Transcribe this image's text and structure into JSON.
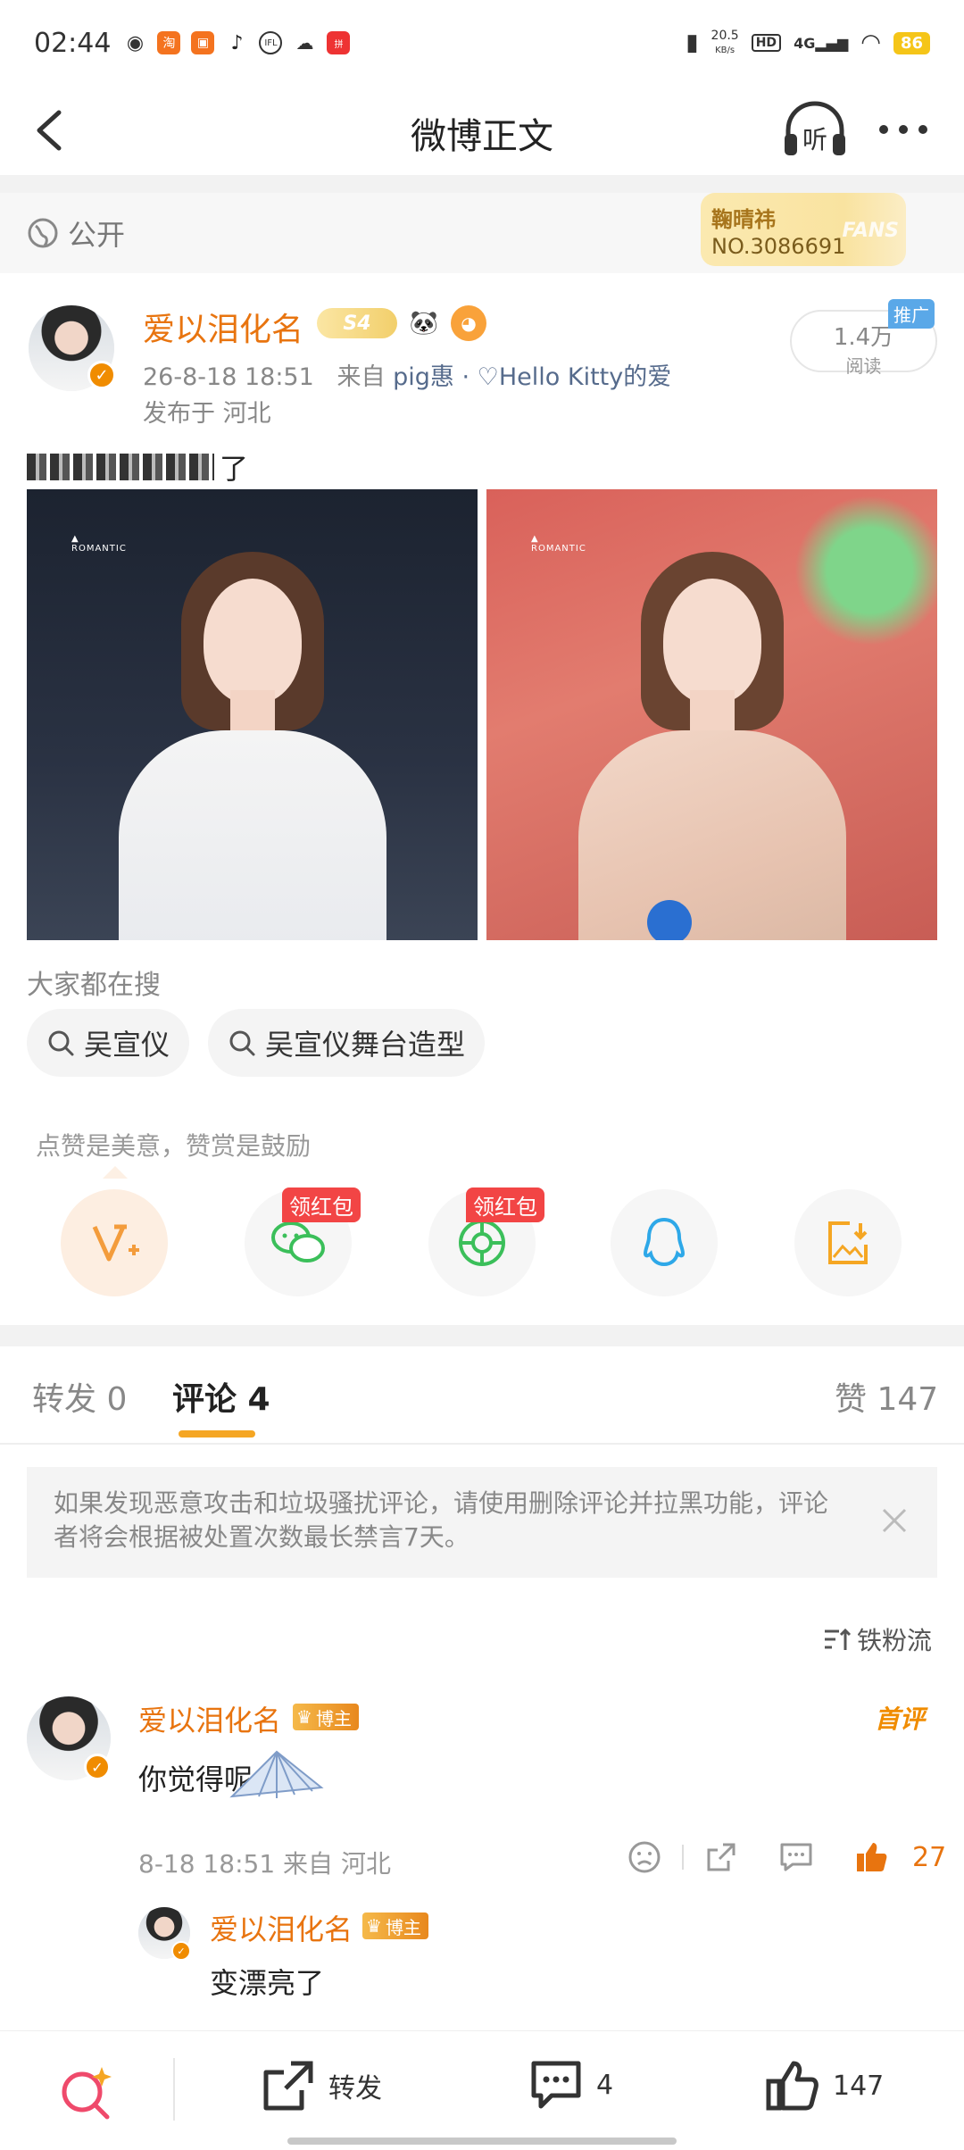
{
  "status_bar": {
    "time": "02:44",
    "net_speed": "20.5",
    "net_unit": "KB/s",
    "hd": "HD",
    "network": "4G",
    "battery": "86"
  },
  "nav": {
    "title": "微博正文",
    "listen_label": "听"
  },
  "visibility": {
    "label": "公开"
  },
  "fans_card": {
    "name": "鞠晴祎",
    "number": "NO.3086691",
    "tag": "FANS"
  },
  "post": {
    "author": "爱以泪化名",
    "level": "S4",
    "timestamp": "26-8-18 18:51",
    "source_prefix": "来自",
    "source": "pig惠 · ♡Hello Kitty的爱",
    "location": "发布于 河北",
    "reads": "1.4万",
    "reads_label": "阅读",
    "promo_tag": "推广",
    "text_suffix": "了"
  },
  "search": {
    "title": "大家都在搜",
    "chips": [
      "吴宣仪",
      "吴宣仪舞台造型"
    ]
  },
  "praise": {
    "text": "点赞是美意，赞赏是鼓励",
    "red_packet": "领红包"
  },
  "tabs": {
    "repost": "转发 0",
    "comments": "评论 4",
    "likes": "赞 147"
  },
  "notice": {
    "text": "如果发现恶意攻击和垃圾骚扰评论，请使用删除评论并拉黑功能，评论者将会根据被处置次数最长禁言7天。"
  },
  "sort": {
    "label": "铁粉流"
  },
  "comments": [
    {
      "author": "爱以泪化名",
      "tag": "博主",
      "first_tag": "首评",
      "text": "你觉得呢",
      "meta": "8-18 18:51 来自 河北",
      "likes": "27"
    }
  ],
  "replies": [
    {
      "author": "爱以泪化名",
      "tag": "博主",
      "text": "变漂亮了"
    }
  ],
  "toolbar": {
    "repost_label": "转发",
    "comment_count": "4",
    "like_count": "147"
  },
  "colors": {
    "accent_orange": "#e8740f",
    "tab_underline": "#f5a623",
    "red_tag": "#f24545"
  }
}
